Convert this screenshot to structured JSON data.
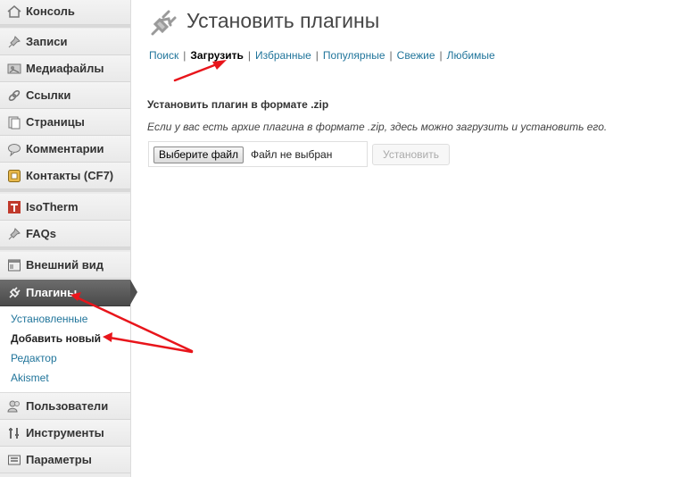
{
  "sidebar": {
    "items": [
      {
        "label": "Консоль",
        "icon": "dashboard-icon"
      },
      {
        "label": "Записи",
        "icon": "pin-icon"
      },
      {
        "label": "Медиафайлы",
        "icon": "media-icon"
      },
      {
        "label": "Ссылки",
        "icon": "link-icon"
      },
      {
        "label": "Страницы",
        "icon": "page-icon"
      },
      {
        "label": "Комментарии",
        "icon": "comment-icon"
      },
      {
        "label": "Контакты (CF7)",
        "icon": "contact-form-icon"
      },
      {
        "label": "IsoTherm",
        "icon": "isotherm-icon"
      },
      {
        "label": "FAQs",
        "icon": "pin-icon"
      },
      {
        "label": "Внешний вид",
        "icon": "appearance-icon"
      },
      {
        "label": "Плагины",
        "icon": "plugin-icon"
      },
      {
        "label": "Пользователи",
        "icon": "users-icon"
      },
      {
        "label": "Инструменты",
        "icon": "tools-icon"
      },
      {
        "label": "Параметры",
        "icon": "settings-icon"
      }
    ],
    "plugins_submenu": [
      "Установленные",
      "Добавить новый",
      "Редактор",
      "Akismet"
    ]
  },
  "header": {
    "title": "Установить плагины"
  },
  "tabs": [
    "Поиск",
    "Загрузить",
    "Избранные",
    "Популярные",
    "Свежие",
    "Любимые"
  ],
  "upload": {
    "heading": "Установить плагин в формате .zip",
    "description": "Если у вас есть архие плагина в формате .zip, здесь можно загрузить и установить его.",
    "choose_file_button": "Выберите файл",
    "file_status": "Файл не выбран",
    "install_button": "Установить"
  },
  "colors": {
    "link": "#21759b",
    "annotation_arrow": "#e8151b",
    "active_menu": "#555555"
  }
}
